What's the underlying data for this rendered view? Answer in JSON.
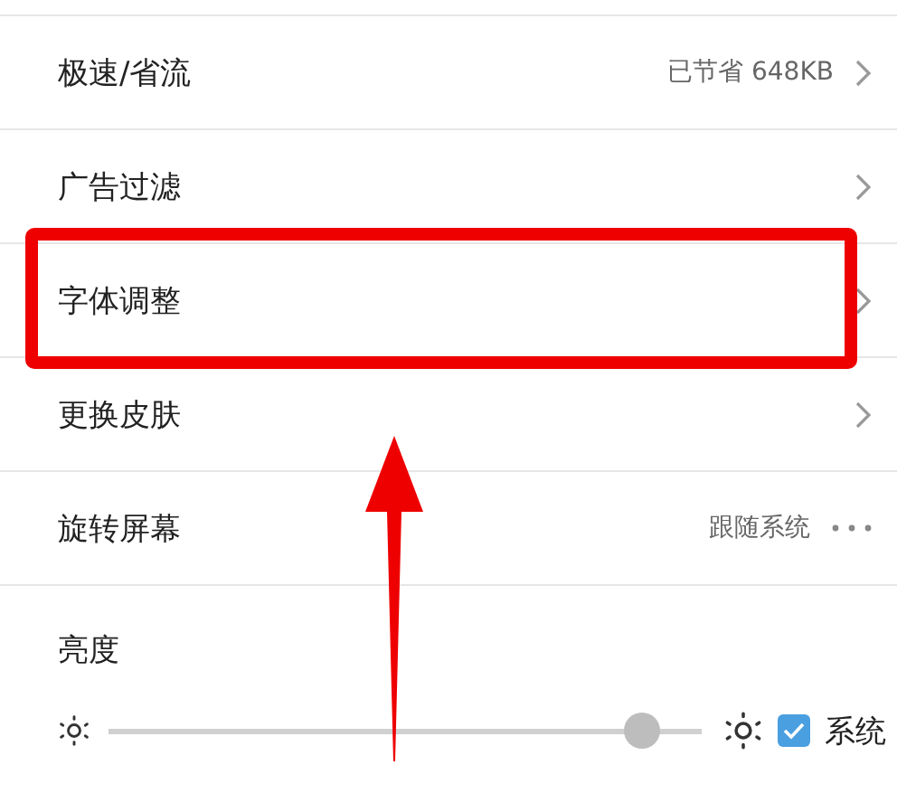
{
  "rows": [
    {
      "kind": "link",
      "label": "极速/省流",
      "value": "已节省 648KB",
      "highlighted": false
    },
    {
      "kind": "link",
      "label": "广告过滤",
      "highlighted": false
    },
    {
      "kind": "link",
      "label": "字体调整",
      "highlighted": true
    },
    {
      "kind": "link",
      "label": "更换皮肤",
      "highlighted": false
    },
    {
      "kind": "menu",
      "label": "旋转屏幕",
      "value": "跟随系统",
      "highlighted": false
    }
  ],
  "brightness": {
    "label": "亮度",
    "level": 0.93,
    "system_label": "系统",
    "system_checked": true
  }
}
